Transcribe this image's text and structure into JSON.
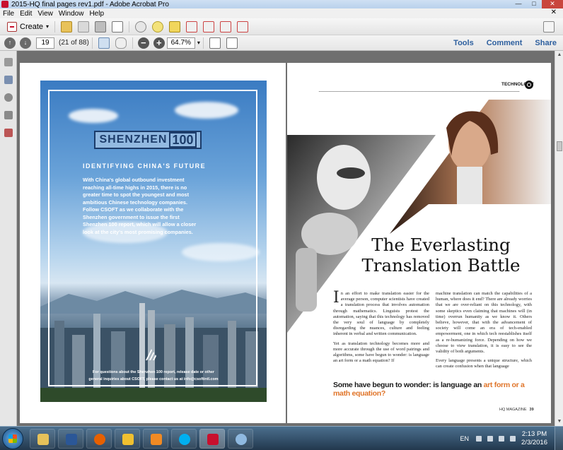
{
  "window": {
    "title": "2015-HQ final pages rev1.pdf - Adobe Acrobat Pro"
  },
  "menu": [
    "File",
    "Edit",
    "View",
    "Window",
    "Help"
  ],
  "toolbar": {
    "create_label": "Create"
  },
  "nav": {
    "page_number": "19",
    "page_count": "(21 of 88)",
    "zoom": "64.7%",
    "right_tabs": [
      "Tools",
      "Comment",
      "Share"
    ]
  },
  "ad": {
    "logo_word": "SHENZHEN",
    "logo_number": "100",
    "heading": "IDENTIFYING CHINA'S FUTURE",
    "body": "With China's global outbound investment reaching all-time highs in 2015, there is no greater time to spot the youngest and most ambitious Chinese technology companies. Follow CSOFT as we collaborate with the Shenzhen government to issue the first Shenzhen 100 report, which will allow a closer look at the city's most promising companies.",
    "footer_line1": "For questions about the Shenzhen 100 report, release date or other",
    "footer_line2": "general inquiries about CSOFT, please contact us at info@csoftintl.com"
  },
  "article": {
    "section": "TECHNOLOGY",
    "headline_line1": "The Everlasting",
    "headline_line2": "Translation Battle",
    "dropcap": "I",
    "col1_p1": "n an effort to make translation easier for the average person, computer scientists have created a translation process that involves automation through mathematics. Linguists protest the automation, saying that this technology has removed the very soul of language by completely disregarding the nuances, culture and feeling inherent in verbal and written communication.",
    "col1_p2": "Yet as translation technology becomes more and more accurate through the use of word pairings and algorithms, some have begun to wonder: is language an art form or a math equation? If",
    "col2_p1": "machine translation can match the capabilities of a human, where does it end? There are already worries that we are over-reliant on this technology, with some skeptics even claiming that machines will (in time) overrun humanity as we know it. Others believe, however, that with the advancement of society will come an era of tech-enabled empowerment, one in which tech reestablishes itself as a re-humanizing force. Depending on how we choose to view translation, it is easy to see the validity of both arguments.",
    "col2_p2": "Every language presents a unique structure, which can create confusion when that language",
    "pullquote_start": "Some have begun to wonder: is language an ",
    "pullquote_accent": "art form or a math equation?",
    "folio_magazine": "HQ MAGAZINE",
    "folio_page": "39"
  },
  "taskbar": {
    "apps": [
      "file-explorer",
      "word",
      "firefox",
      "outlook",
      "media-player",
      "skype",
      "acrobat",
      "paint"
    ],
    "language": "EN",
    "time": "2:13 PM",
    "date": "2/3/2016"
  },
  "colors": {
    "accent_orange": "#e0752a",
    "link_blue": "#2d5f9e",
    "logo_navy": "#1c3c6a"
  }
}
